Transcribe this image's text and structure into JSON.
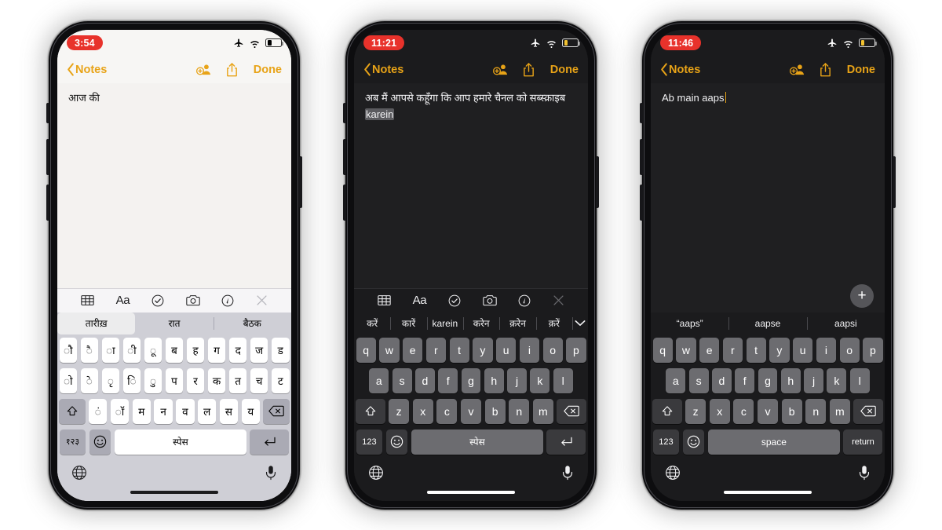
{
  "phones": [
    {
      "id": "phone-1",
      "theme": "light",
      "status": {
        "time": "3:54",
        "airplane_icon": "airplane-icon",
        "wifi_icon": "wifi-icon",
        "battery_icon": "battery-icon",
        "battery_level": 28
      },
      "nav": {
        "back_label": "Notes",
        "collab_icon": "add-person-icon",
        "share_icon": "share-icon",
        "done_label": "Done",
        "accent": "#e8a317"
      },
      "note": {
        "text": "आज की",
        "highlight": "",
        "caret": false
      },
      "toolbar": [
        "table-icon",
        "format-aa-icon",
        "checklist-icon",
        "camera-icon",
        "markup-pen-icon",
        "close-icon"
      ],
      "toolbar_aa_label": "Aa",
      "predictions": [
        {
          "label": "तारीख़",
          "selected": true
        },
        {
          "label": "रात",
          "selected": false
        },
        {
          "label": "बैठक",
          "selected": false
        }
      ],
      "has_chevron": false,
      "fab": null,
      "keyboard": {
        "language": "devanagari",
        "row1": [
          "ौ",
          "ै",
          "ा",
          "ी",
          "ू",
          "ब",
          "ह",
          "ग",
          "द",
          "ज",
          "ड"
        ],
        "row2": [
          "ो",
          "े",
          "ृ",
          "ि",
          "ु",
          "प",
          "र",
          "क",
          "त",
          "च",
          "ट"
        ],
        "row3": [
          "ं",
          "ॉ",
          "म",
          "न",
          "व",
          "ल",
          "स",
          "य"
        ],
        "shift_icon": "shift-icon",
        "delete_icon": "delete-icon",
        "numeric_label": "१२३",
        "emoji_icon": "emoji-icon",
        "space_label": "स्पेस",
        "return_icon": "return-icon",
        "globe_icon": "globe-icon",
        "mic_icon": "microphone-icon"
      }
    },
    {
      "id": "phone-2",
      "theme": "dark",
      "status": {
        "time": "11:21",
        "airplane_icon": "airplane-icon",
        "wifi_icon": "wifi-icon",
        "battery_icon": "battery-icon",
        "battery_level": 22
      },
      "nav": {
        "back_label": "Notes",
        "collab_icon": "add-person-icon",
        "share_icon": "share-icon",
        "done_label": "Done",
        "accent": "#e8a317"
      },
      "note": {
        "text": "अब मैं आपसे कहूँगा कि आप हमारे चैनल को सब्स्क्राइब ",
        "highlight": "karein",
        "caret": false
      },
      "toolbar": [
        "table-icon",
        "format-aa-icon",
        "checklist-icon",
        "camera-icon",
        "markup-pen-icon",
        "close-icon"
      ],
      "toolbar_aa_label": "Aa",
      "predictions": [
        {
          "label": "करें",
          "selected": false
        },
        {
          "label": "कारें",
          "selected": false
        },
        {
          "label": "karein",
          "selected": false
        },
        {
          "label": "करेन",
          "selected": false
        },
        {
          "label": "क़रेन",
          "selected": false
        },
        {
          "label": "क़रें",
          "selected": false
        }
      ],
      "has_chevron": true,
      "chevron_icon": "chevron-down-icon",
      "fab": null,
      "keyboard": {
        "language": "qwerty",
        "row1": [
          "q",
          "w",
          "e",
          "r",
          "t",
          "y",
          "u",
          "i",
          "o",
          "p"
        ],
        "row2": [
          "a",
          "s",
          "d",
          "f",
          "g",
          "h",
          "j",
          "k",
          "l"
        ],
        "row3": [
          "z",
          "x",
          "c",
          "v",
          "b",
          "n",
          "m"
        ],
        "shift_icon": "shift-icon",
        "delete_icon": "delete-icon",
        "numeric_label": "123",
        "emoji_icon": "emoji-icon",
        "space_label": "स्पेस",
        "return_icon": "return-icon",
        "globe_icon": "globe-icon",
        "mic_icon": "microphone-icon"
      }
    },
    {
      "id": "phone-3",
      "theme": "dark",
      "status": {
        "time": "11:46",
        "airplane_icon": "airplane-icon",
        "wifi_icon": "wifi-icon",
        "battery_icon": "battery-icon",
        "battery_level": 22
      },
      "nav": {
        "back_label": "Notes",
        "collab_icon": "add-person-icon",
        "share_icon": "share-icon",
        "done_label": "Done",
        "accent": "#e8a317"
      },
      "note": {
        "text": "Ab main aaps",
        "highlight": "",
        "caret": true
      },
      "toolbar": [],
      "toolbar_aa_label": "",
      "predictions": [
        {
          "label": "“aaps”",
          "selected": false
        },
        {
          "label": "aapse",
          "selected": false
        },
        {
          "label": "aapsi",
          "selected": false
        }
      ],
      "has_chevron": false,
      "fab": {
        "label": "+",
        "icon": "add-icon"
      },
      "keyboard": {
        "language": "qwerty",
        "row1": [
          "q",
          "w",
          "e",
          "r",
          "t",
          "y",
          "u",
          "i",
          "o",
          "p"
        ],
        "row2": [
          "a",
          "s",
          "d",
          "f",
          "g",
          "h",
          "j",
          "k",
          "l"
        ],
        "row3": [
          "z",
          "x",
          "c",
          "v",
          "b",
          "n",
          "m"
        ],
        "shift_icon": "shift-icon",
        "delete_icon": "delete-icon",
        "numeric_label": "123",
        "emoji_icon": "emoji-icon",
        "space_label": "space",
        "return_label": "return",
        "return_icon": "",
        "globe_icon": "globe-icon",
        "mic_icon": "microphone-icon"
      }
    }
  ]
}
